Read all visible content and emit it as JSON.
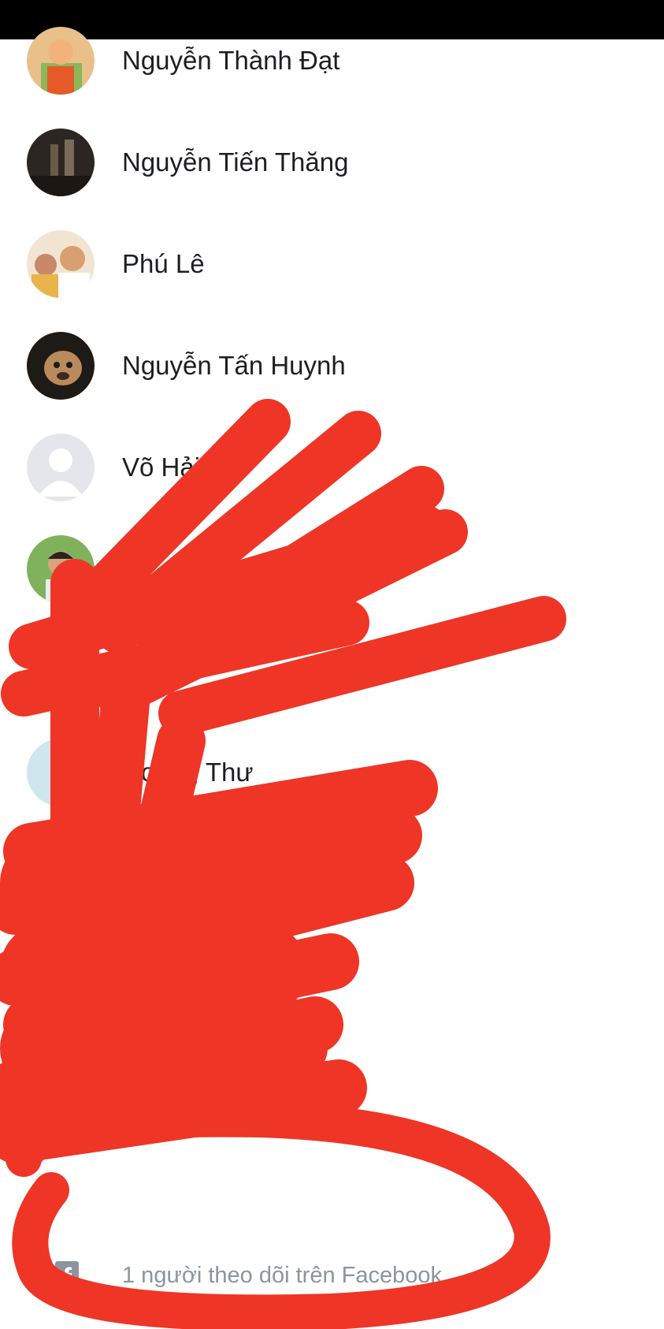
{
  "friends": [
    {
      "name": "Nguyễn Thành Đạt"
    },
    {
      "name": "Nguyễn Tiến Thăng"
    },
    {
      "name": "Phú Lê"
    },
    {
      "name": "Nguyễn Tấn Huynh"
    },
    {
      "name": "Võ Hải"
    },
    {
      "name": ""
    },
    {
      "name": ""
    },
    {
      "name": "Hoàng Thư"
    }
  ],
  "footer": {
    "text": "1 người theo dõi trên Facebook",
    "icon": "facebook-icon",
    "icon_glyph": "f"
  },
  "colors": {
    "redaction": "#ee3526",
    "status_bar": "#000000",
    "footer_text": "#8d949e"
  }
}
